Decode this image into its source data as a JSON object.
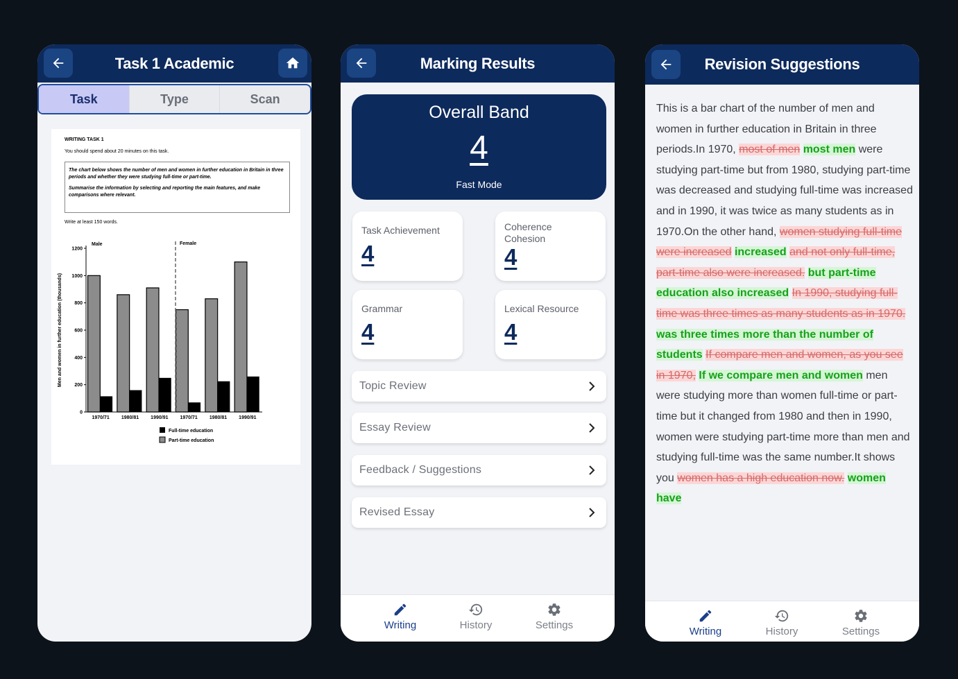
{
  "screens": {
    "task": {
      "title": "Task 1 Academic",
      "tabs": [
        {
          "label": "Task",
          "active": true
        },
        {
          "label": "Type",
          "active": false
        },
        {
          "label": "Scan",
          "active": false
        }
      ],
      "task_image": {
        "heading": "WRITING TASK 1",
        "time_note": "You should spend about 20 minutes on this task.",
        "prompt": "The chart below shows the number of men and women in further education in Britain in three periods and whether they were studying full-time or part-time.",
        "instruction": "Summarise the information by selecting and reporting the main features, and make comparisons where relevant.",
        "word_note": "Write at least 150 words."
      }
    },
    "marking": {
      "title": "Marking Results",
      "overall": {
        "title": "Overall Band",
        "value": "4",
        "mode": "Fast Mode"
      },
      "scores": [
        {
          "label": "Task Achievement",
          "value": "4"
        },
        {
          "label": "Coherence Cohesion",
          "value": "4"
        },
        {
          "label": "Grammar",
          "value": "4"
        },
        {
          "label": "Lexical Resource",
          "value": "4"
        }
      ],
      "rows": [
        "Topic Review",
        "Essay Review",
        "Feedback / Suggestions",
        "Revised Essay"
      ]
    },
    "revision": {
      "title": "Revision Suggestions",
      "segments": [
        {
          "t": "This is a bar chart of the number of men and women in further education in Britain in three periods.In 1970, ",
          "k": "n"
        },
        {
          "t": "most of men",
          "k": "d"
        },
        {
          "t": " ",
          "k": "n"
        },
        {
          "t": "most men",
          "k": "i"
        },
        {
          "t": " were studying part-time but from 1980, studying part-time was decreased and studying full-time was increased and in 1990, it was twice as many students as in 1970.On the other hand, ",
          "k": "n"
        },
        {
          "t": "women studying full-time were increased",
          "k": "d"
        },
        {
          "t": " ",
          "k": "n"
        },
        {
          "t": "increased",
          "k": "i"
        },
        {
          "t": " ",
          "k": "n"
        },
        {
          "t": "and not only full-time, part-time also were increased.",
          "k": "d"
        },
        {
          "t": " ",
          "k": "n"
        },
        {
          "t": "but part-time education also increased",
          "k": "i"
        },
        {
          "t": " ",
          "k": "n"
        },
        {
          "t": "In 1990, studying full-time was three times as many students as in 1970.",
          "k": "d"
        },
        {
          "t": " ",
          "k": "n"
        },
        {
          "t": "was three times more than the number of students",
          "k": "i"
        },
        {
          "t": " ",
          "k": "n"
        },
        {
          "t": "If compare men and women, as you see in 1970,",
          "k": "d"
        },
        {
          "t": " ",
          "k": "n"
        },
        {
          "t": "If we compare men and women",
          "k": "i"
        },
        {
          "t": " men were studying more than women full-time or part-time but it changed from 1980 and then in 1990, women were studying part-time more than men and studying full-time was the same number.It shows you ",
          "k": "n"
        },
        {
          "t": "women has a high education now.",
          "k": "d"
        },
        {
          "t": " ",
          "k": "n"
        },
        {
          "t": "women have",
          "k": "i"
        }
      ]
    }
  },
  "nav": [
    {
      "label": "Writing",
      "icon": "pencil-icon",
      "active": true
    },
    {
      "label": "History",
      "icon": "history-icon",
      "active": false
    },
    {
      "label": "Settings",
      "icon": "gear-icon",
      "active": false
    }
  ],
  "colors": {
    "header": "#0d2a5c",
    "active_tab": "#c8c9f5",
    "deleted_bg": "#fcd6d6",
    "inserted_bg": "#d6f5d6"
  },
  "chart_data": {
    "type": "bar",
    "groups": [
      "Male",
      "Female"
    ],
    "categories": [
      "1970/71",
      "1980/81",
      "1990/91",
      "1970/71",
      "1980/81",
      "1990/91"
    ],
    "series": [
      {
        "name": "Full-time education",
        "values": [
          115,
          160,
          250,
          70,
          225,
          260
        ]
      },
      {
        "name": "Part-time education",
        "values": [
          1000,
          860,
          910,
          750,
          830,
          1100
        ]
      }
    ],
    "ylabel": "Men and women in further education (thousands)",
    "ylim": [
      0,
      1200
    ],
    "yticks": [
      "0",
      "200",
      "400",
      "600",
      "800",
      "1000",
      "1200"
    ]
  }
}
